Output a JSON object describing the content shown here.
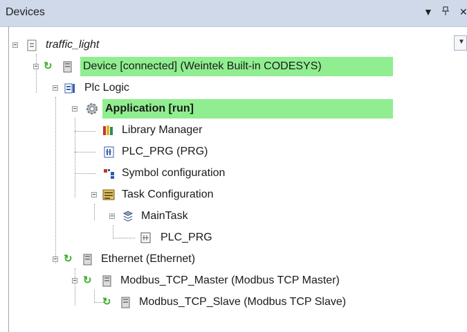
{
  "panel": {
    "title": "Devices",
    "dropdown_icon": "chevron-down-icon",
    "pin_icon": "pin-icon",
    "close_icon": "close-icon",
    "highlight_color": "#90ee90"
  },
  "tree": {
    "project": "traffic_light",
    "device": "Device [connected] (Weintek Built-in CODESYS)",
    "plc_logic": "Plc Logic",
    "application": "Application [run]",
    "library_manager": "Library Manager",
    "plc_prg": "PLC_PRG (PRG)",
    "symbol_configuration": "Symbol configuration",
    "task_configuration": "Task Configuration",
    "main_task": "MainTask",
    "task_plc_prg": "PLC_PRG",
    "ethernet": "Ethernet (Ethernet)",
    "modbus_master": "Modbus_TCP_Master (Modbus TCP Master)",
    "modbus_slave": "Modbus_TCP_Slave (Modbus TCP Slave)"
  }
}
